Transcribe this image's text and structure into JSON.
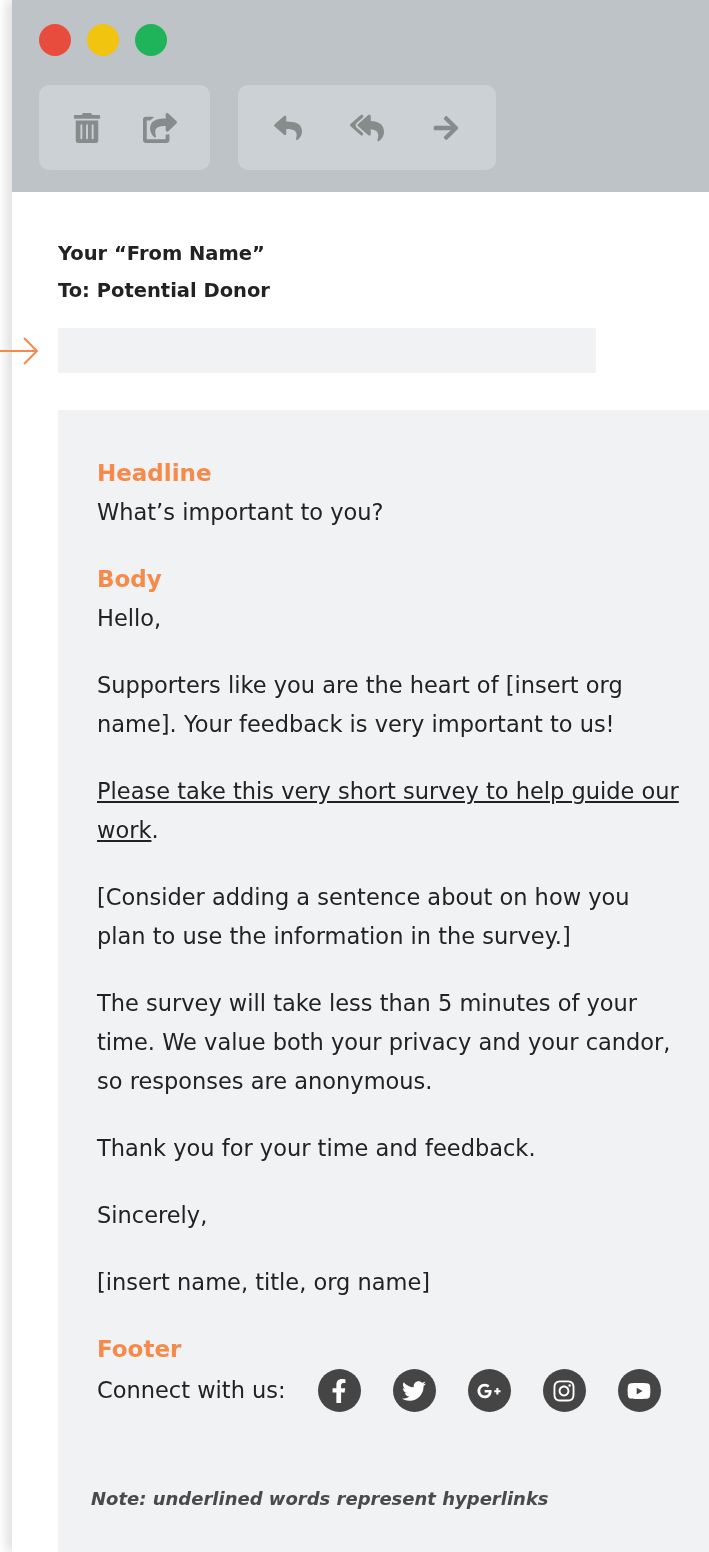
{
  "window_controls": [
    {
      "color": "#e84c3d"
    },
    {
      "color": "#f1c40f"
    },
    {
      "color": "#20b45a"
    }
  ],
  "from": "Your “From Name”",
  "to": "To: Potential Donor",
  "sections": [
    {
      "heading": "Headline",
      "paragraphs": [
        {
          "kind": "text",
          "text": "What’s important to you?"
        }
      ]
    },
    {
      "heading": "Body",
      "paragraphs": [
        {
          "kind": "text",
          "text": "Hello,"
        },
        {
          "kind": "text",
          "text": "Supporters like you are the heart of [insert org name]. Your feedback is very important to us!"
        },
        {
          "kind": "link",
          "link": "Please take this very short survey to help guide our work",
          "after": "."
        },
        {
          "kind": "text",
          "text": "[Consider adding a sentence about on how you plan to use the information in the survey.]"
        },
        {
          "kind": "text",
          "text": "The survey will take less than 5 minutes of your time. We value both your privacy and your candor, so responses are anonymous."
        },
        {
          "kind": "text",
          "text": "Thank you for your time and feedback."
        },
        {
          "kind": "text",
          "text": "Sincerely,"
        },
        {
          "kind": "text",
          "text": "[insert name, title, org name]"
        }
      ]
    }
  ],
  "footer": {
    "heading": "Footer",
    "connect_label": "Connect with us:"
  },
  "note": "Note: underlined words represent hyperlinks"
}
